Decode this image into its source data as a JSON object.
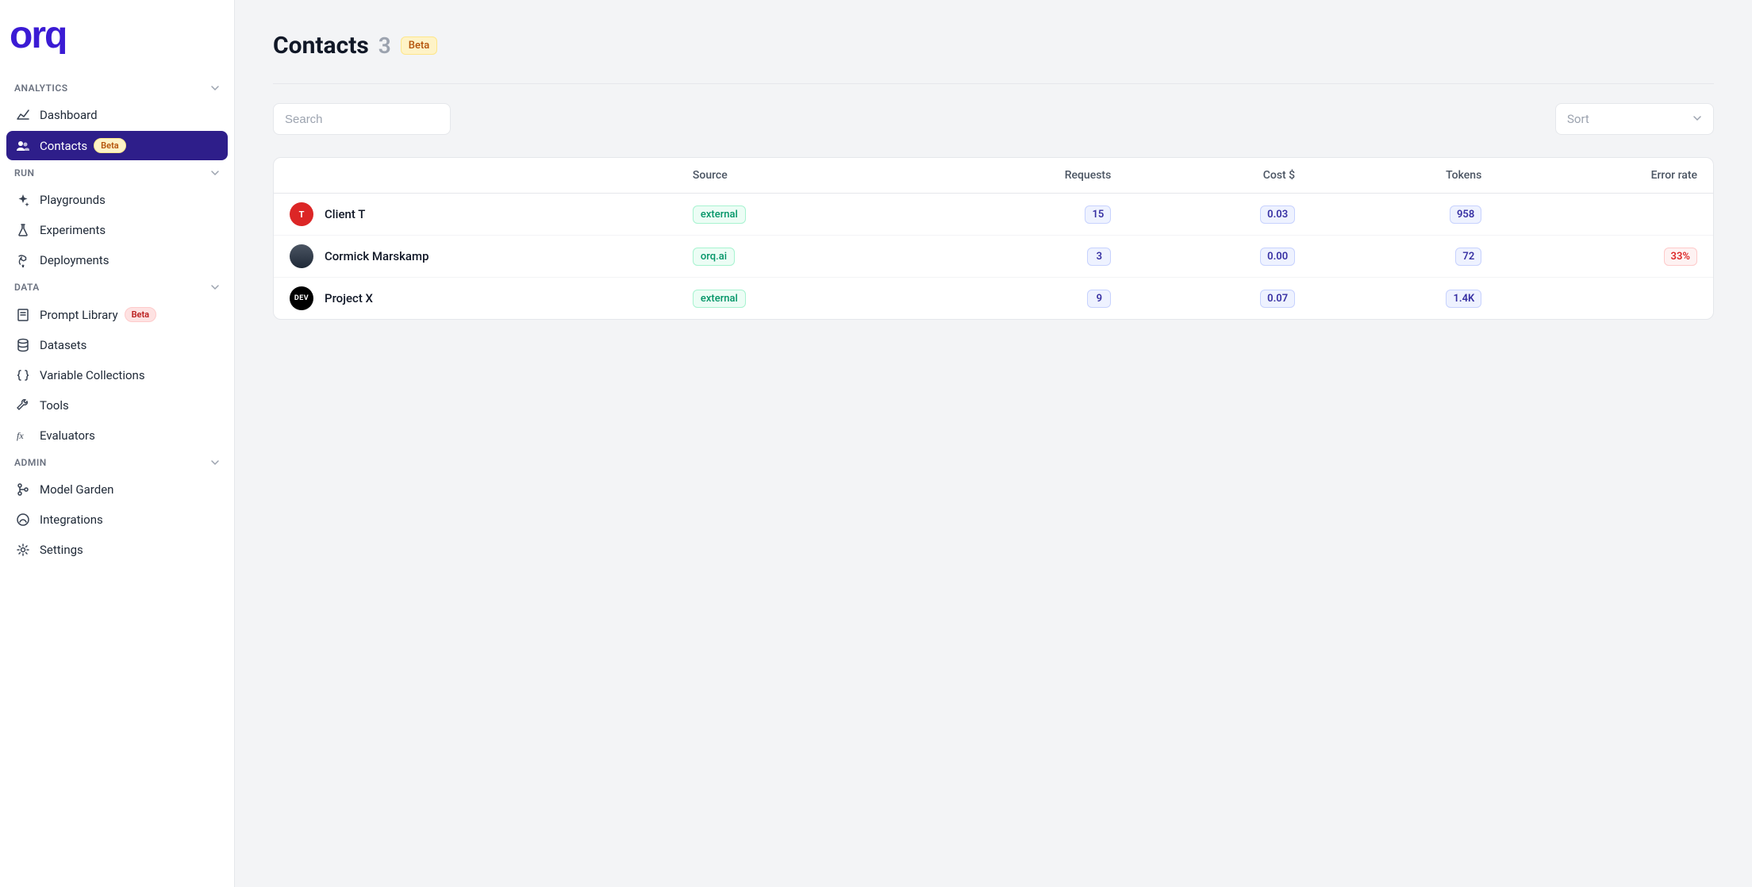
{
  "brand": "orq",
  "sidebar": {
    "sections": [
      {
        "label": "ANALYTICS",
        "items": [
          {
            "label": "Dashboard",
            "active": false,
            "beta": false
          },
          {
            "label": "Contacts",
            "active": true,
            "beta": true
          }
        ]
      },
      {
        "label": "RUN",
        "items": [
          {
            "label": "Playgrounds",
            "active": false,
            "beta": false
          },
          {
            "label": "Experiments",
            "active": false,
            "beta": false
          },
          {
            "label": "Deployments",
            "active": false,
            "beta": false
          }
        ]
      },
      {
        "label": "DATA",
        "items": [
          {
            "label": "Prompt Library",
            "active": false,
            "beta": true
          },
          {
            "label": "Datasets",
            "active": false,
            "beta": false
          },
          {
            "label": "Variable Collections",
            "active": false,
            "beta": false
          },
          {
            "label": "Tools",
            "active": false,
            "beta": false
          },
          {
            "label": "Evaluators",
            "active": false,
            "beta": false
          }
        ]
      },
      {
        "label": "ADMIN",
        "items": [
          {
            "label": "Model Garden",
            "active": false,
            "beta": false
          },
          {
            "label": "Integrations",
            "active": false,
            "beta": false
          },
          {
            "label": "Settings",
            "active": false,
            "beta": false
          }
        ]
      }
    ],
    "beta_label": "Beta"
  },
  "header": {
    "title": "Contacts",
    "count": "3",
    "beta_label": "Beta"
  },
  "controls": {
    "search_placeholder": "Search",
    "sort_placeholder": "Sort"
  },
  "table": {
    "columns": [
      "",
      "Source",
      "Requests",
      "Cost $",
      "Tokens",
      "Error rate"
    ],
    "rows": [
      {
        "name": "Client T",
        "avatar": "T",
        "avatar_color": "red",
        "source": "external",
        "requests": "15",
        "cost": "0.03",
        "tokens": "958",
        "error_rate": ""
      },
      {
        "name": "Cormick Marskamp",
        "avatar": "",
        "avatar_color": "gray",
        "source": "orq.ai",
        "requests": "3",
        "cost": "0.00",
        "tokens": "72",
        "error_rate": "33%"
      },
      {
        "name": "Project X",
        "avatar": "DEV",
        "avatar_color": "black",
        "source": "external",
        "requests": "9",
        "cost": "0.07",
        "tokens": "1.4K",
        "error_rate": ""
      }
    ]
  }
}
